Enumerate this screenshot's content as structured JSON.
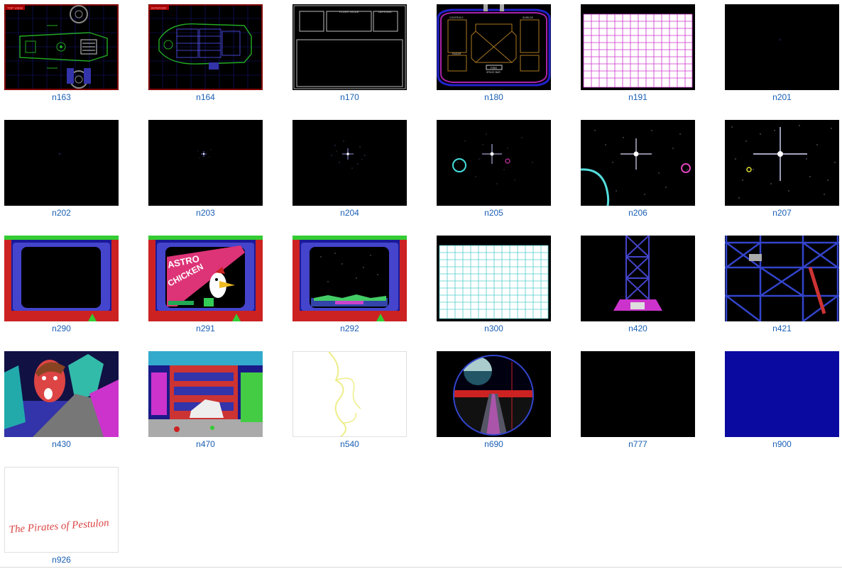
{
  "files": [
    {
      "name": "n163"
    },
    {
      "name": "n164"
    },
    {
      "name": "n170"
    },
    {
      "name": "n180"
    },
    {
      "name": "n191"
    },
    {
      "name": "n201"
    },
    {
      "name": "n202"
    },
    {
      "name": "n203"
    },
    {
      "name": "n204"
    },
    {
      "name": "n205"
    },
    {
      "name": "n206"
    },
    {
      "name": "n207"
    },
    {
      "name": "n290"
    },
    {
      "name": "n291"
    },
    {
      "name": "n292"
    },
    {
      "name": "n300"
    },
    {
      "name": "n420"
    },
    {
      "name": "n421"
    },
    {
      "name": "n430"
    },
    {
      "name": "n470"
    },
    {
      "name": "n540"
    },
    {
      "name": "n690"
    },
    {
      "name": "n777"
    },
    {
      "name": "n900"
    },
    {
      "name": "n926"
    }
  ],
  "thumb_text": {
    "n163_label": "TOP VIEW",
    "n164_label": "INTERIOR",
    "n170_flight": "FLIGHT MODE",
    "n170_defense": "DEFENSE",
    "n180_controls": "CONTROLS",
    "n180_shields": "SHIELDS",
    "n180_radar": "RADAR",
    "n180_fire": "FIRE",
    "n180_spacebar": "SPACE BAR",
    "n291_title1": "ASTRO",
    "n291_title2": "CHICKEN",
    "n926_title": "The Pirates of Pestulon"
  }
}
